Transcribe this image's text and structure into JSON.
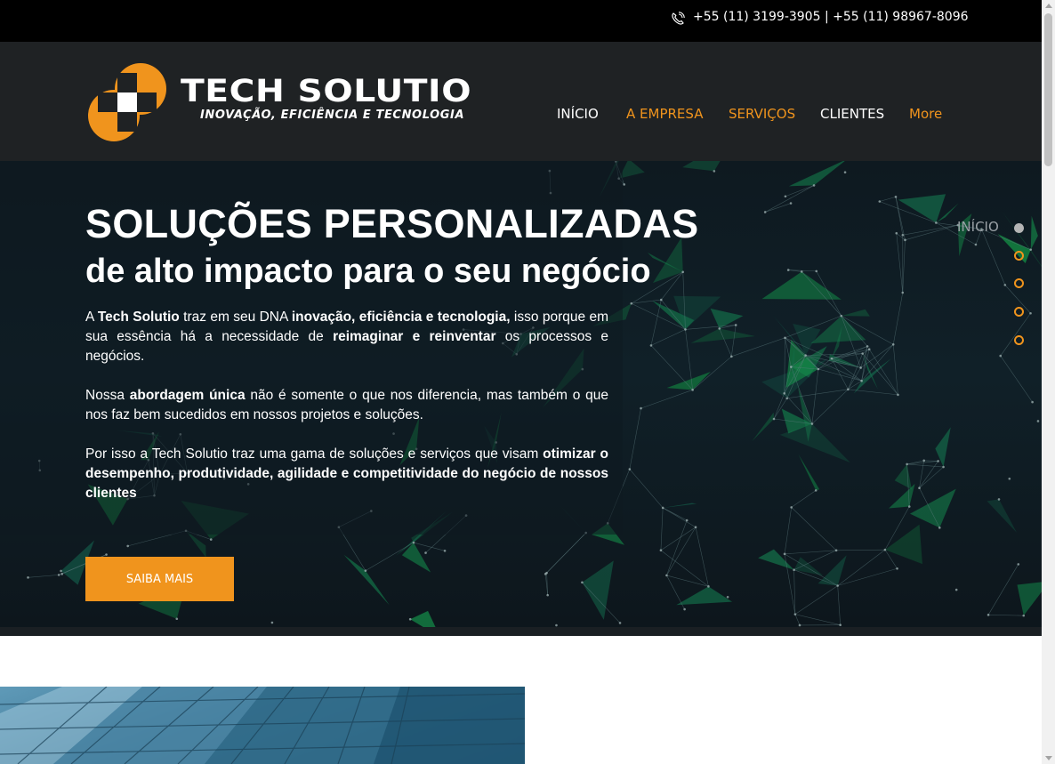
{
  "topbar": {
    "phone_icon": "phone-ring-icon",
    "phones": "+55 (11) 3199-3905 | +55 (11) 98967-8096"
  },
  "brand": {
    "name": "TECH SOLUTIO",
    "tagline": "INOVAÇÃO, EFICIÊNCIA E TECNOLOGIA",
    "colors": {
      "orange": "#f0941d",
      "white": "#ffffff"
    }
  },
  "nav": {
    "items": [
      {
        "label": "INÍCIO",
        "color": "#ffffff"
      },
      {
        "label": "A EMPRESA",
        "color": "#f0941d"
      },
      {
        "label": "SERVIÇOS",
        "color": "#f0941d"
      },
      {
        "label": "CLIENTES",
        "color": "#ffffff"
      },
      {
        "label": "More",
        "color": "#f0941d"
      }
    ]
  },
  "hero": {
    "title": "SOLUÇÕES PERSONALIZADAS",
    "subtitle": "de alto impacto para o seu negócio",
    "paragraphs": [
      [
        {
          "t": "A ",
          "b": false
        },
        {
          "t": "Tech Solutio",
          "b": true
        },
        {
          "t": " traz em seu DNA ",
          "b": false
        },
        {
          "t": "inovação, eficiência e tecnologia,",
          "b": true
        },
        {
          "t": " isso porque em sua essência há a necessidade de ",
          "b": false
        },
        {
          "t": "reimaginar e reinventar",
          "b": true
        },
        {
          "t": " os processos e negócios.",
          "b": false
        }
      ],
      [
        {
          "t": "Nossa ",
          "b": false
        },
        {
          "t": "abordagem única",
          "b": true
        },
        {
          "t": " não é somente o que nos diferencia, mas também o que nos faz bem sucedidos em nossos projetos e soluções.",
          "b": false
        }
      ],
      [
        {
          "t": "Por isso a Tech Solutio traz uma gama de soluções e serviços que visam ",
          "b": false
        },
        {
          "t": "otimizar o desempenho, produtividade, agilidade e competitividade do negócio de nossos clientes",
          "b": true
        }
      ]
    ],
    "cta_label": "SAIBA MAIS",
    "section_nav": {
      "active_label": "INÍCIO",
      "dot_count": 5
    }
  }
}
